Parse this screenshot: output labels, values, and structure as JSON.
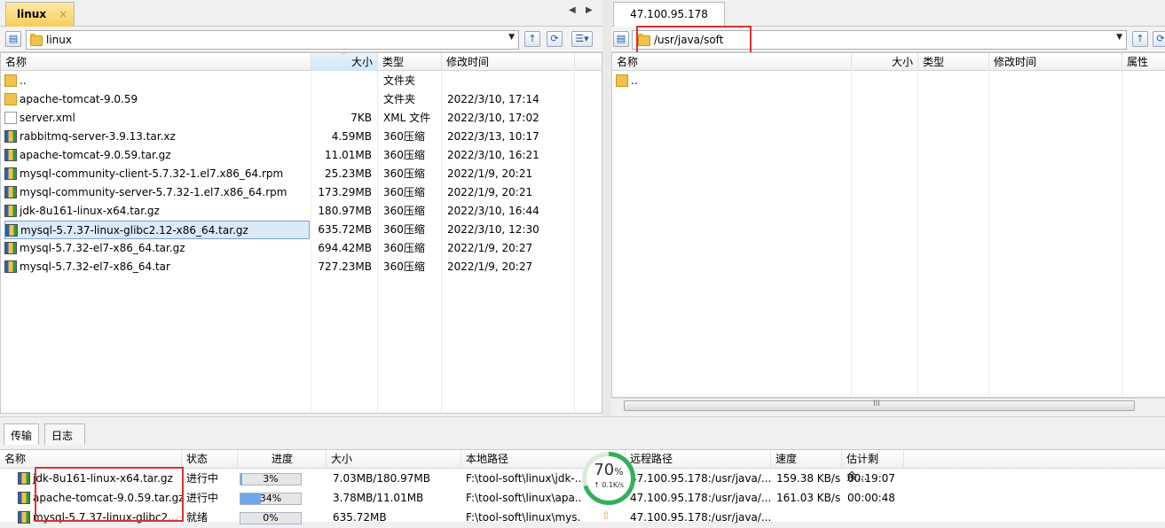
{
  "left": {
    "tab_label": "linux",
    "tab_close": "×",
    "nav_prev": "◀",
    "nav_next": "▶",
    "path": "linux",
    "columns": [
      "名称",
      "大小",
      "类型",
      "修改时间"
    ],
    "rows": [
      {
        "name": "..",
        "size": "",
        "type": "文件夹",
        "mtime": "",
        "icon": "folder-icon"
      },
      {
        "name": "apache-tomcat-9.0.59",
        "size": "",
        "type": "文件夹",
        "mtime": "2022/3/10, 17:14",
        "icon": "folder-icon"
      },
      {
        "name": "server.xml",
        "size": "7KB",
        "type": "XML 文件",
        "mtime": "2022/3/10, 17:02",
        "icon": "xml-file-icon"
      },
      {
        "name": "rabbitmq-server-3.9.13.tar.xz",
        "size": "4.59MB",
        "type": "360压缩",
        "mtime": "2022/3/13, 10:17",
        "icon": "archive-icon"
      },
      {
        "name": "apache-tomcat-9.0.59.tar.gz",
        "size": "11.01MB",
        "type": "360压缩",
        "mtime": "2022/3/10, 16:21",
        "icon": "archive-icon"
      },
      {
        "name": "mysql-community-client-5.7.32-1.el7.x86_64.rpm",
        "size": "25.23MB",
        "type": "360压缩",
        "mtime": "2022/1/9, 20:21",
        "icon": "archive-icon"
      },
      {
        "name": "mysql-community-server-5.7.32-1.el7.x86_64.rpm",
        "size": "173.29MB",
        "type": "360压缩",
        "mtime": "2022/1/9, 20:21",
        "icon": "archive-icon"
      },
      {
        "name": "jdk-8u161-linux-x64.tar.gz",
        "size": "180.97MB",
        "type": "360压缩",
        "mtime": "2022/3/10, 16:44",
        "icon": "archive-icon"
      },
      {
        "name": "mysql-5.7.37-linux-glibc2.12-x86_64.tar.gz",
        "size": "635.72MB",
        "type": "360压缩",
        "mtime": "2022/3/10, 12:30",
        "icon": "archive-icon"
      },
      {
        "name": "mysql-5.7.32-el7-x86_64.tar.gz",
        "size": "694.42MB",
        "type": "360压缩",
        "mtime": "2022/1/9, 20:27",
        "icon": "archive-icon"
      },
      {
        "name": "mysql-5.7.32-el7-x86_64.tar",
        "size": "727.23MB",
        "type": "360压缩",
        "mtime": "2022/1/9, 20:27",
        "icon": "archive-icon"
      }
    ],
    "selected_row": "mysql-5.7.37-linux-glibc2.12-x86_64.tar.gz"
  },
  "right": {
    "tab_label": "47.100.95.178",
    "path": "/usr/java/soft",
    "columns": [
      "名称",
      "大小",
      "类型",
      "修改时间",
      "属性"
    ],
    "rows": [
      {
        "name": "..",
        "icon": "folder-icon"
      }
    ],
    "scroll_grip": "III"
  },
  "bottom": {
    "tabs": [
      "传输",
      "日志"
    ],
    "columns": [
      "名称",
      "状态",
      "进度",
      "大小",
      "本地路径",
      "远程路径",
      "速度",
      "估计剩余..."
    ],
    "transfers": [
      {
        "name": "jdk-8u161-linux-x64.tar.gz",
        "status": "进行中",
        "progress": 3,
        "progress_label": "3%",
        "size": "7.03MB/180.97MB",
        "local": "F:\\tool-soft\\linux\\jdk-...",
        "remote": "47.100.95.178:/usr/java/...",
        "speed": "159.38 KB/s",
        "eta": "00:19:07"
      },
      {
        "name": "apache-tomcat-9.0.59.tar.gz",
        "status": "进行中",
        "progress": 34,
        "progress_label": "34%",
        "size": "3.78MB/11.01MB",
        "local": "F:\\tool-soft\\linux\\apa...",
        "remote": "47.100.95.178:/usr/java/...",
        "speed": "161.03 KB/s",
        "eta": "00:00:48"
      },
      {
        "name": "mysql-5.7.37-linux-glibc2...",
        "status": "就绪",
        "progress": 0,
        "progress_label": "0%",
        "size": "635.72MB",
        "local": "F:\\tool-soft\\linux\\mys...",
        "remote": "47.100.95.178:/usr/java/...",
        "speed": "",
        "eta": ""
      }
    ],
    "gauge": {
      "percent": "70",
      "percent_sign": "%",
      "rate": "↑ 0.1K/s"
    }
  },
  "colors": {
    "accent": "#e03030",
    "progress": "#6fa8e8",
    "gauge": "#32b05a"
  }
}
